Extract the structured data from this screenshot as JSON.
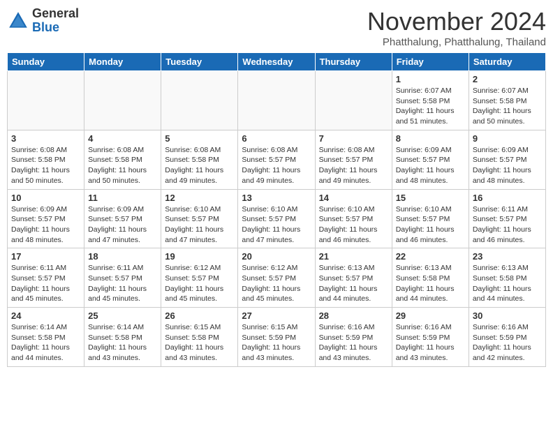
{
  "header": {
    "logo_general": "General",
    "logo_blue": "Blue",
    "title": "November 2024",
    "subtitle": "Phatthalung, Phatthalung, Thailand"
  },
  "weekdays": [
    "Sunday",
    "Monday",
    "Tuesday",
    "Wednesday",
    "Thursday",
    "Friday",
    "Saturday"
  ],
  "weeks": [
    [
      {
        "day": "",
        "empty": true
      },
      {
        "day": "",
        "empty": true
      },
      {
        "day": "",
        "empty": true
      },
      {
        "day": "",
        "empty": true
      },
      {
        "day": "",
        "empty": true
      },
      {
        "day": "1",
        "sunrise": "6:07 AM",
        "sunset": "5:58 PM",
        "daylight": "11 hours and 51 minutes."
      },
      {
        "day": "2",
        "sunrise": "6:07 AM",
        "sunset": "5:58 PM",
        "daylight": "11 hours and 50 minutes."
      }
    ],
    [
      {
        "day": "3",
        "sunrise": "6:08 AM",
        "sunset": "5:58 PM",
        "daylight": "11 hours and 50 minutes."
      },
      {
        "day": "4",
        "sunrise": "6:08 AM",
        "sunset": "5:58 PM",
        "daylight": "11 hours and 50 minutes."
      },
      {
        "day": "5",
        "sunrise": "6:08 AM",
        "sunset": "5:58 PM",
        "daylight": "11 hours and 49 minutes."
      },
      {
        "day": "6",
        "sunrise": "6:08 AM",
        "sunset": "5:57 PM",
        "daylight": "11 hours and 49 minutes."
      },
      {
        "day": "7",
        "sunrise": "6:08 AM",
        "sunset": "5:57 PM",
        "daylight": "11 hours and 49 minutes."
      },
      {
        "day": "8",
        "sunrise": "6:09 AM",
        "sunset": "5:57 PM",
        "daylight": "11 hours and 48 minutes."
      },
      {
        "day": "9",
        "sunrise": "6:09 AM",
        "sunset": "5:57 PM",
        "daylight": "11 hours and 48 minutes."
      }
    ],
    [
      {
        "day": "10",
        "sunrise": "6:09 AM",
        "sunset": "5:57 PM",
        "daylight": "11 hours and 48 minutes."
      },
      {
        "day": "11",
        "sunrise": "6:09 AM",
        "sunset": "5:57 PM",
        "daylight": "11 hours and 47 minutes."
      },
      {
        "day": "12",
        "sunrise": "6:10 AM",
        "sunset": "5:57 PM",
        "daylight": "11 hours and 47 minutes."
      },
      {
        "day": "13",
        "sunrise": "6:10 AM",
        "sunset": "5:57 PM",
        "daylight": "11 hours and 47 minutes."
      },
      {
        "day": "14",
        "sunrise": "6:10 AM",
        "sunset": "5:57 PM",
        "daylight": "11 hours and 46 minutes."
      },
      {
        "day": "15",
        "sunrise": "6:10 AM",
        "sunset": "5:57 PM",
        "daylight": "11 hours and 46 minutes."
      },
      {
        "day": "16",
        "sunrise": "6:11 AM",
        "sunset": "5:57 PM",
        "daylight": "11 hours and 46 minutes."
      }
    ],
    [
      {
        "day": "17",
        "sunrise": "6:11 AM",
        "sunset": "5:57 PM",
        "daylight": "11 hours and 45 minutes."
      },
      {
        "day": "18",
        "sunrise": "6:11 AM",
        "sunset": "5:57 PM",
        "daylight": "11 hours and 45 minutes."
      },
      {
        "day": "19",
        "sunrise": "6:12 AM",
        "sunset": "5:57 PM",
        "daylight": "11 hours and 45 minutes."
      },
      {
        "day": "20",
        "sunrise": "6:12 AM",
        "sunset": "5:57 PM",
        "daylight": "11 hours and 45 minutes."
      },
      {
        "day": "21",
        "sunrise": "6:13 AM",
        "sunset": "5:57 PM",
        "daylight": "11 hours and 44 minutes."
      },
      {
        "day": "22",
        "sunrise": "6:13 AM",
        "sunset": "5:58 PM",
        "daylight": "11 hours and 44 minutes."
      },
      {
        "day": "23",
        "sunrise": "6:13 AM",
        "sunset": "5:58 PM",
        "daylight": "11 hours and 44 minutes."
      }
    ],
    [
      {
        "day": "24",
        "sunrise": "6:14 AM",
        "sunset": "5:58 PM",
        "daylight": "11 hours and 44 minutes."
      },
      {
        "day": "25",
        "sunrise": "6:14 AM",
        "sunset": "5:58 PM",
        "daylight": "11 hours and 43 minutes."
      },
      {
        "day": "26",
        "sunrise": "6:15 AM",
        "sunset": "5:58 PM",
        "daylight": "11 hours and 43 minutes."
      },
      {
        "day": "27",
        "sunrise": "6:15 AM",
        "sunset": "5:59 PM",
        "daylight": "11 hours and 43 minutes."
      },
      {
        "day": "28",
        "sunrise": "6:16 AM",
        "sunset": "5:59 PM",
        "daylight": "11 hours and 43 minutes."
      },
      {
        "day": "29",
        "sunrise": "6:16 AM",
        "sunset": "5:59 PM",
        "daylight": "11 hours and 43 minutes."
      },
      {
        "day": "30",
        "sunrise": "6:16 AM",
        "sunset": "5:59 PM",
        "daylight": "11 hours and 42 minutes."
      }
    ]
  ]
}
